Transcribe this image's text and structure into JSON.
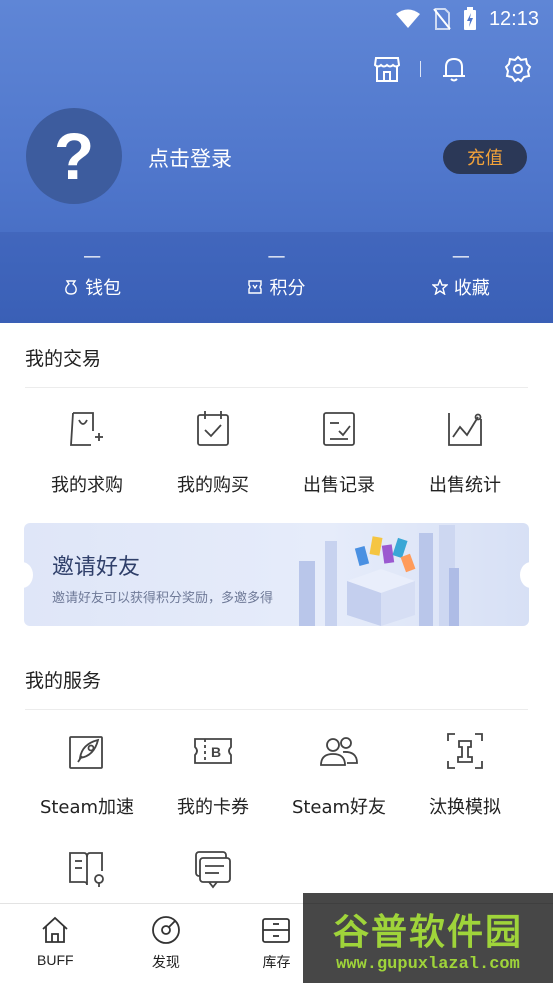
{
  "status_bar": {
    "time": "12:13"
  },
  "profile": {
    "avatar_glyph": "?",
    "login_text": "点击登录",
    "recharge_label": "充值"
  },
  "stats": [
    {
      "value": "—",
      "label": "钱包",
      "icon": "wallet-icon"
    },
    {
      "value": "—",
      "label": "积分",
      "icon": "points-icon"
    },
    {
      "value": "—",
      "label": "收藏",
      "icon": "star-icon"
    }
  ],
  "trade": {
    "title": "我的交易",
    "items": [
      {
        "label": "我的求购",
        "icon": "purchase-request-icon"
      },
      {
        "label": "我的购买",
        "icon": "my-purchases-icon"
      },
      {
        "label": "出售记录",
        "icon": "sale-record-icon"
      },
      {
        "label": "出售统计",
        "icon": "sale-stats-icon"
      }
    ]
  },
  "invite": {
    "title": "邀请好友",
    "subtitle": "邀请好友可以获得积分奖励，多邀多得"
  },
  "services": {
    "title": "我的服务",
    "items": [
      {
        "label": "Steam加速",
        "icon": "rocket-icon"
      },
      {
        "label": "我的卡券",
        "icon": "coupon-icon"
      },
      {
        "label": "Steam好友",
        "icon": "friends-icon"
      },
      {
        "label": "汰换模拟",
        "icon": "tradeup-icon"
      },
      {
        "label": "",
        "icon": "guide-book-icon"
      },
      {
        "label": "",
        "icon": "feedback-icon"
      }
    ]
  },
  "bottom_nav": [
    {
      "label": "BUFF",
      "icon": "home-icon"
    },
    {
      "label": "发现",
      "icon": "discover-icon"
    },
    {
      "label": "库存",
      "icon": "inventory-icon"
    },
    {
      "label": "",
      "icon": ""
    },
    {
      "label": "",
      "icon": ""
    }
  ],
  "watermark": {
    "text": "谷普软件园",
    "url": "www.gupuxlazal.com"
  },
  "colors": {
    "header_blue": "#5178cc",
    "recharge_text": "#f2a23a",
    "watermark_green": "#9fd43a"
  }
}
